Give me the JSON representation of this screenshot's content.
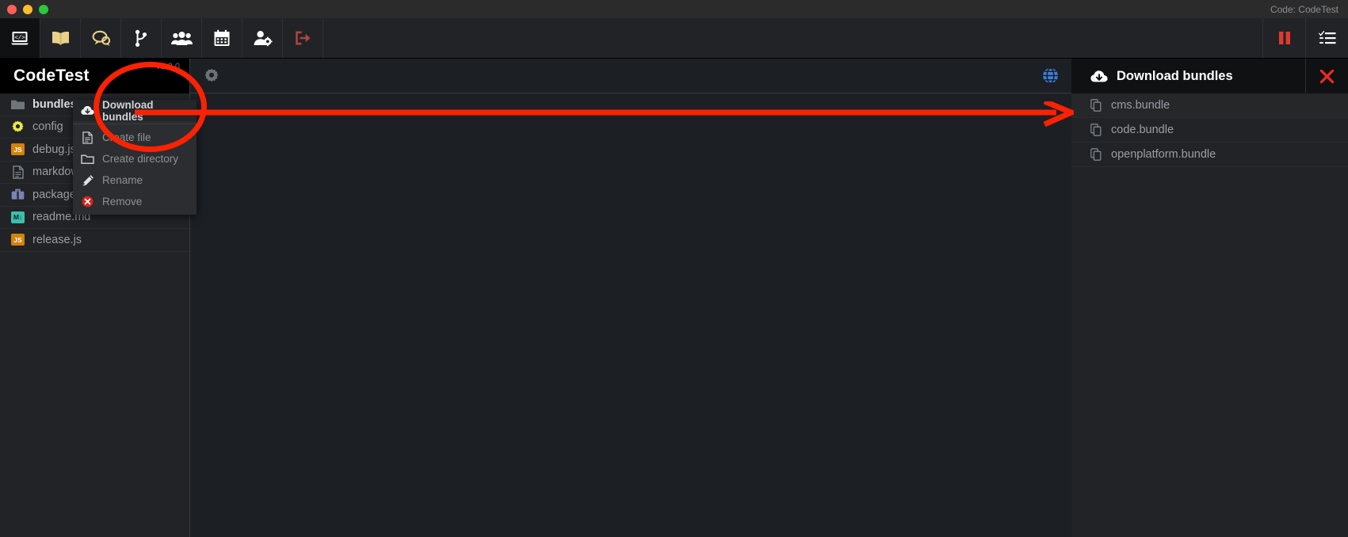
{
  "window": {
    "title_right": "Code: CodeTest",
    "traffic_lights": [
      "close",
      "minimize",
      "maximize"
    ]
  },
  "topbar": {
    "items": [
      {
        "name": "code-editor-icon",
        "label": "Code",
        "active": true
      },
      {
        "name": "book-icon",
        "label": "Docs",
        "active": false
      },
      {
        "name": "chat-icon",
        "label": "Chat",
        "active": false
      },
      {
        "name": "git-branch-icon",
        "label": "Branches",
        "active": false
      },
      {
        "name": "users-icon",
        "label": "Users",
        "active": false
      },
      {
        "name": "calendar-icon",
        "label": "Calendar",
        "active": false
      },
      {
        "name": "user-settings-icon",
        "label": "Account",
        "active": false
      },
      {
        "name": "logout-icon",
        "label": "Logout",
        "active": false
      }
    ],
    "right_items": [
      {
        "name": "pause-icon",
        "label": "Pause"
      },
      {
        "name": "checklist-icon",
        "label": "Tasks"
      }
    ]
  },
  "sidebar": {
    "title": "CodeTest",
    "version": "v1.3.0",
    "files": [
      {
        "name": "bundles",
        "icon": "folder-icon",
        "type": "folder"
      },
      {
        "name": "config",
        "icon": "gear-icon",
        "type": "config"
      },
      {
        "name": "debug.js",
        "icon": "js-badge",
        "type": "js"
      },
      {
        "name": "markdown",
        "icon": "document-icon",
        "type": "doc"
      },
      {
        "name": "package.json",
        "icon": "package-icon",
        "type": "package"
      },
      {
        "name": "readme.md",
        "icon": "md-badge",
        "type": "md"
      },
      {
        "name": "release.js",
        "icon": "js-badge",
        "type": "js"
      }
    ]
  },
  "context_menu": {
    "items": [
      {
        "label": "Download bundles",
        "icon": "cloud-download-icon",
        "highlight": true
      },
      {
        "label": "Create file",
        "icon": "document-icon",
        "highlight": false
      },
      {
        "label": "Create directory",
        "icon": "folder-outline-icon",
        "highlight": false
      },
      {
        "label": "Rename",
        "icon": "pencil-icon",
        "highlight": false
      },
      {
        "label": "Remove",
        "icon": "remove-circle-icon",
        "highlight": false
      }
    ]
  },
  "main_toolbar": {
    "left_icon": "gear-icon",
    "right_icon": "globe-icon"
  },
  "right_panel": {
    "title": "Download bundles",
    "title_icon": "cloud-download-icon",
    "close_icon": "close-icon",
    "bundles": [
      {
        "label": "cms.bundle",
        "icon": "copy-icon"
      },
      {
        "label": "code.bundle",
        "icon": "copy-icon"
      },
      {
        "label": "openplatform.bundle",
        "icon": "copy-icon"
      }
    ]
  },
  "annotations": {
    "circle": {
      "name": "highlight-circle",
      "color": "#fb2203"
    },
    "arrow": {
      "name": "pointer-arrow",
      "color": "#fb2203"
    }
  }
}
